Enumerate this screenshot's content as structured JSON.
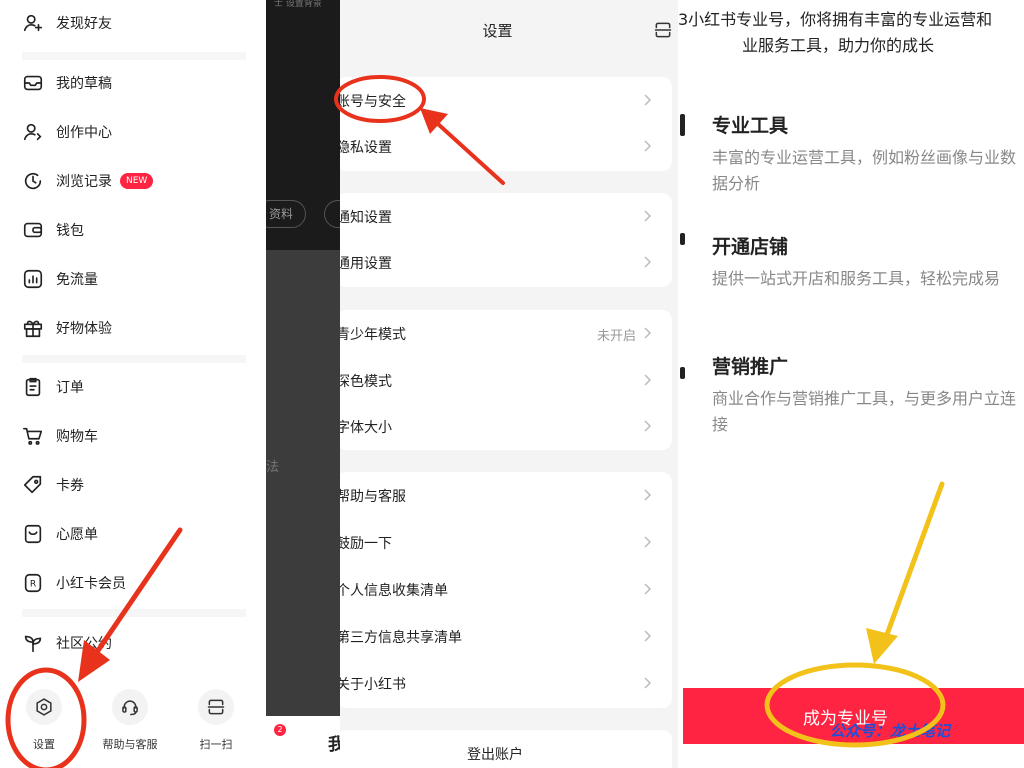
{
  "drawer": {
    "items": [
      {
        "label": "发现好友",
        "icon": "add-user-icon"
      },
      {
        "label": "我的草稿",
        "icon": "drafts-tray-icon"
      },
      {
        "label": "创作中心",
        "icon": "creator-user-icon"
      },
      {
        "label": "浏览记录",
        "icon": "history-clock-icon",
        "badge": "NEW"
      },
      {
        "label": "钱包",
        "icon": "wallet-icon"
      },
      {
        "label": "免流量",
        "icon": "data-chart-icon"
      },
      {
        "label": "好物体验",
        "icon": "gift-box-icon"
      },
      {
        "label": "订单",
        "icon": "order-clipboard-icon"
      },
      {
        "label": "购物车",
        "icon": "cart-icon"
      },
      {
        "label": "卡券",
        "icon": "coupon-tag-icon"
      },
      {
        "label": "心愿单",
        "icon": "wishlist-icon"
      },
      {
        "label": "小红卡会员",
        "icon": "r-card-icon"
      },
      {
        "label": "社区公约",
        "icon": "sprout-icon"
      }
    ],
    "bottom": {
      "settings": "设置",
      "help": "帮助与客服",
      "scan": "扫一扫"
    },
    "background_view": {
      "chip_a": "资料",
      "tab_me": "我",
      "ghost_text": "法",
      "tab_badge": "2",
      "top_strip_text": "士 设置背景"
    }
  },
  "settings": {
    "title": "设置",
    "groups": [
      {
        "rows": [
          {
            "label": "账号与安全"
          },
          {
            "label": "隐私设置"
          }
        ]
      },
      {
        "rows": [
          {
            "label": "通知设置"
          },
          {
            "label": "通用设置"
          }
        ]
      },
      {
        "rows": [
          {
            "label": "青少年模式",
            "value": "未开启"
          },
          {
            "label": "深色模式"
          },
          {
            "label": "字体大小"
          }
        ]
      },
      {
        "rows": [
          {
            "label": "帮助与客服"
          },
          {
            "label": "鼓励一下"
          },
          {
            "label": "个人信息收集清单"
          },
          {
            "label": "第三方信息共享清单"
          },
          {
            "label": "关于小红书"
          }
        ]
      }
    ],
    "logout": "登出账户"
  },
  "pro": {
    "intro_line1": "3小红书专业号，你将拥有丰富的专业运营和",
    "intro_line2": "业服务工具，助力你的成长",
    "features": [
      {
        "title": "专业工具",
        "desc": "丰富的专业运营工具，例如粉丝画像与业数据分析"
      },
      {
        "title": "开通店铺",
        "desc": "提供一站式开店和服务工具，轻松完成易"
      },
      {
        "title": "营销推广",
        "desc": "商业合作与营销推广工具，与更多用户立连接"
      }
    ],
    "cta": "成为专业号",
    "watermark": "公众号：龙土笔记"
  },
  "colors": {
    "brand_red": "#ff2442",
    "annotation_red": "#e8321c",
    "annotation_yellow": "#f2c21b",
    "watermark_blue": "#1e4fd8"
  }
}
